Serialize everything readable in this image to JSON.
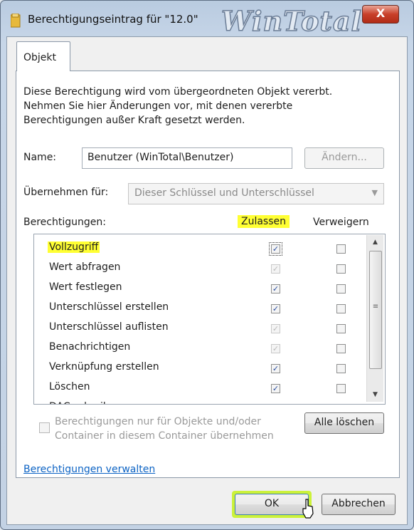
{
  "window": {
    "title": "Berechtigungseintrag für \"12.0\"",
    "watermark": "WinTotal",
    "close_label": "X"
  },
  "tab": {
    "label": "Objekt"
  },
  "description": "Diese Berechtigung wird vom übergeordneten Objekt vererbt.\nNehmen Sie hier Änderungen vor, mit denen vererbte\nBerechtigungen außer Kraft gesetzt werden.",
  "name_field": {
    "label": "Name:",
    "value": "Benutzer (WinTotal\\Benutzer)",
    "change_button": "Ändern..."
  },
  "apply_to": {
    "label": "Übernehmen für:",
    "value": "Dieser Schlüssel und Unterschlüssel"
  },
  "permissions": {
    "header": "Berechtigungen:",
    "allow_header": "Zulassen",
    "deny_header": "Verweigern",
    "rows": [
      {
        "name": "Vollzugriff",
        "allow": "checked",
        "deny": "unchecked"
      },
      {
        "name": "Wert abfragen",
        "allow": "inherited",
        "deny": "unchecked"
      },
      {
        "name": "Wert festlegen",
        "allow": "checked",
        "deny": "unchecked"
      },
      {
        "name": "Unterschlüssel erstellen",
        "allow": "checked",
        "deny": "unchecked"
      },
      {
        "name": "Unterschlüssel auflisten",
        "allow": "inherited",
        "deny": "unchecked"
      },
      {
        "name": "Benachrichtigen",
        "allow": "inherited",
        "deny": "unchecked"
      },
      {
        "name": "Verknüpfung erstellen",
        "allow": "checked",
        "deny": "unchecked"
      },
      {
        "name": "Löschen",
        "allow": "checked",
        "deny": "unchecked"
      },
      {
        "name": "DAC schreiben",
        "allow": "checked",
        "deny": "unchecked"
      }
    ]
  },
  "inherit_option": {
    "text": "Berechtigungen nur für Objekte und/oder\nContainer in diesem Container übernehmen",
    "clear_all_button": "Alle löschen"
  },
  "manage_link": "Berechtigungen verwalten",
  "footer": {
    "ok_label": "OK",
    "cancel_label": "Abbrechen"
  },
  "colors": {
    "highlight": "#ffff33",
    "ok_glow": "#ccf23a",
    "link": "#0c63c4",
    "check": "#2c4f9e"
  }
}
